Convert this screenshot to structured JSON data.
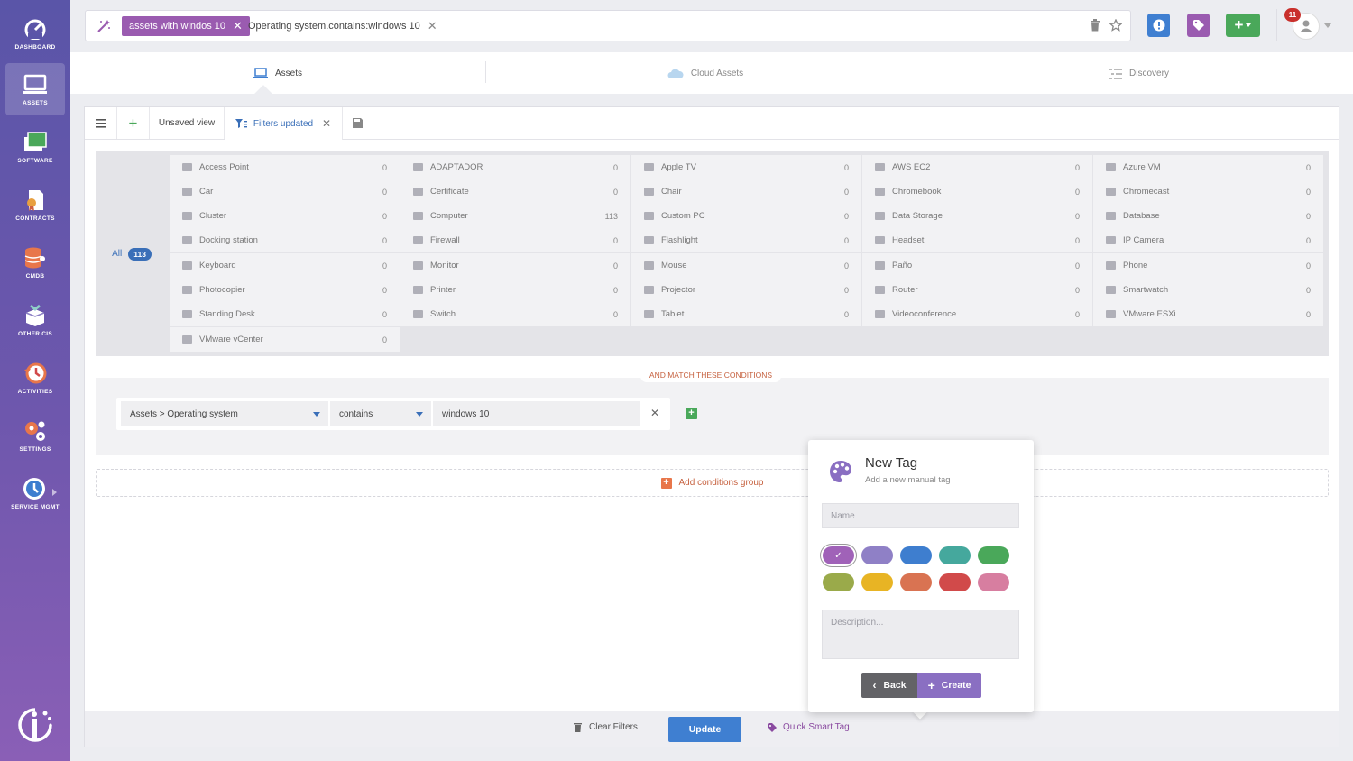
{
  "sidebar": {
    "items": [
      {
        "label": "DASHBOARD",
        "icon": "dashboard-icon"
      },
      {
        "label": "ASSETS",
        "icon": "monitor-icon"
      },
      {
        "label": "SOFTWARE",
        "icon": "software-icon"
      },
      {
        "label": "CONTRACTS",
        "icon": "contract-icon"
      },
      {
        "label": "CMDB",
        "icon": "database-icon"
      },
      {
        "label": "OTHER CIS",
        "icon": "box-icon"
      },
      {
        "label": "ACTIVITIES",
        "icon": "history-icon"
      },
      {
        "label": "SETTINGS",
        "icon": "gears-icon"
      },
      {
        "label": "SERVICE MGMT",
        "icon": "service-icon"
      }
    ]
  },
  "search": {
    "tag_chip": "assets with windos 10",
    "filter_chip": "Operating system.contains:windows 10"
  },
  "header": {
    "notification_count": "11"
  },
  "main_tabs": [
    "Assets",
    "Cloud Assets",
    "Discovery"
  ],
  "viewbar": {
    "view_name": "Unsaved view",
    "filters_label": "Filters updated"
  },
  "types": {
    "all_label": "All",
    "all_count": "113",
    "items": [
      {
        "name": "Access Point",
        "count": "0"
      },
      {
        "name": "ADAPTADOR",
        "count": "0"
      },
      {
        "name": "Apple TV",
        "count": "0"
      },
      {
        "name": "AWS EC2",
        "count": "0"
      },
      {
        "name": "Azure VM",
        "count": "0"
      },
      {
        "name": "Car",
        "count": "0"
      },
      {
        "name": "Certificate",
        "count": "0"
      },
      {
        "name": "Chair",
        "count": "0"
      },
      {
        "name": "Chromebook",
        "count": "0"
      },
      {
        "name": "Chromecast",
        "count": "0"
      },
      {
        "name": "Cluster",
        "count": "0"
      },
      {
        "name": "Computer",
        "count": "113"
      },
      {
        "name": "Custom PC",
        "count": "0"
      },
      {
        "name": "Data Storage",
        "count": "0"
      },
      {
        "name": "Database",
        "count": "0"
      },
      {
        "name": "Docking station",
        "count": "0"
      },
      {
        "name": "Firewall",
        "count": "0"
      },
      {
        "name": "Flashlight",
        "count": "0"
      },
      {
        "name": "Headset",
        "count": "0"
      },
      {
        "name": "IP Camera",
        "count": "0"
      },
      {
        "name": "Keyboard",
        "count": "0"
      },
      {
        "name": "Monitor",
        "count": "0"
      },
      {
        "name": "Mouse",
        "count": "0"
      },
      {
        "name": "Paño",
        "count": "0"
      },
      {
        "name": "Phone",
        "count": "0"
      },
      {
        "name": "Photocopier",
        "count": "0"
      },
      {
        "name": "Printer",
        "count": "0"
      },
      {
        "name": "Projector",
        "count": "0"
      },
      {
        "name": "Router",
        "count": "0"
      },
      {
        "name": "Smartwatch",
        "count": "0"
      },
      {
        "name": "Standing Desk",
        "count": "0"
      },
      {
        "name": "Switch",
        "count": "0"
      },
      {
        "name": "Tablet",
        "count": "0"
      },
      {
        "name": "Videoconference",
        "count": "0"
      },
      {
        "name": "VMware ESXi",
        "count": "0"
      },
      {
        "name": "VMware vCenter",
        "count": "0"
      }
    ]
  },
  "conditions": {
    "match_label": "AND MATCH THESE CONDITIONS",
    "field": "Assets > Operating system",
    "operator": "contains",
    "value": "windows 10",
    "add_group": "Add conditions group"
  },
  "bottom": {
    "clear": "Clear Filters",
    "update": "Update",
    "quick_tag": "Quick Smart Tag"
  },
  "new_tag": {
    "title": "New Tag",
    "subtitle": "Add a new manual tag",
    "name_placeholder": "Name",
    "description_placeholder": "Description...",
    "back": "Back",
    "create": "Create",
    "colors": [
      "#a062b8",
      "#8f80c6",
      "#3e7ecf",
      "#45a89d",
      "#4aa85a",
      "#9aaa4a",
      "#e8b424",
      "#d97352",
      "#d14a4a",
      "#d77ea0"
    ],
    "selected_color": 0
  },
  "theme": {
    "accent_purple": "#9a5bb0",
    "primary_blue": "#3f7fd1",
    "accent_orange": "#c6613f"
  }
}
